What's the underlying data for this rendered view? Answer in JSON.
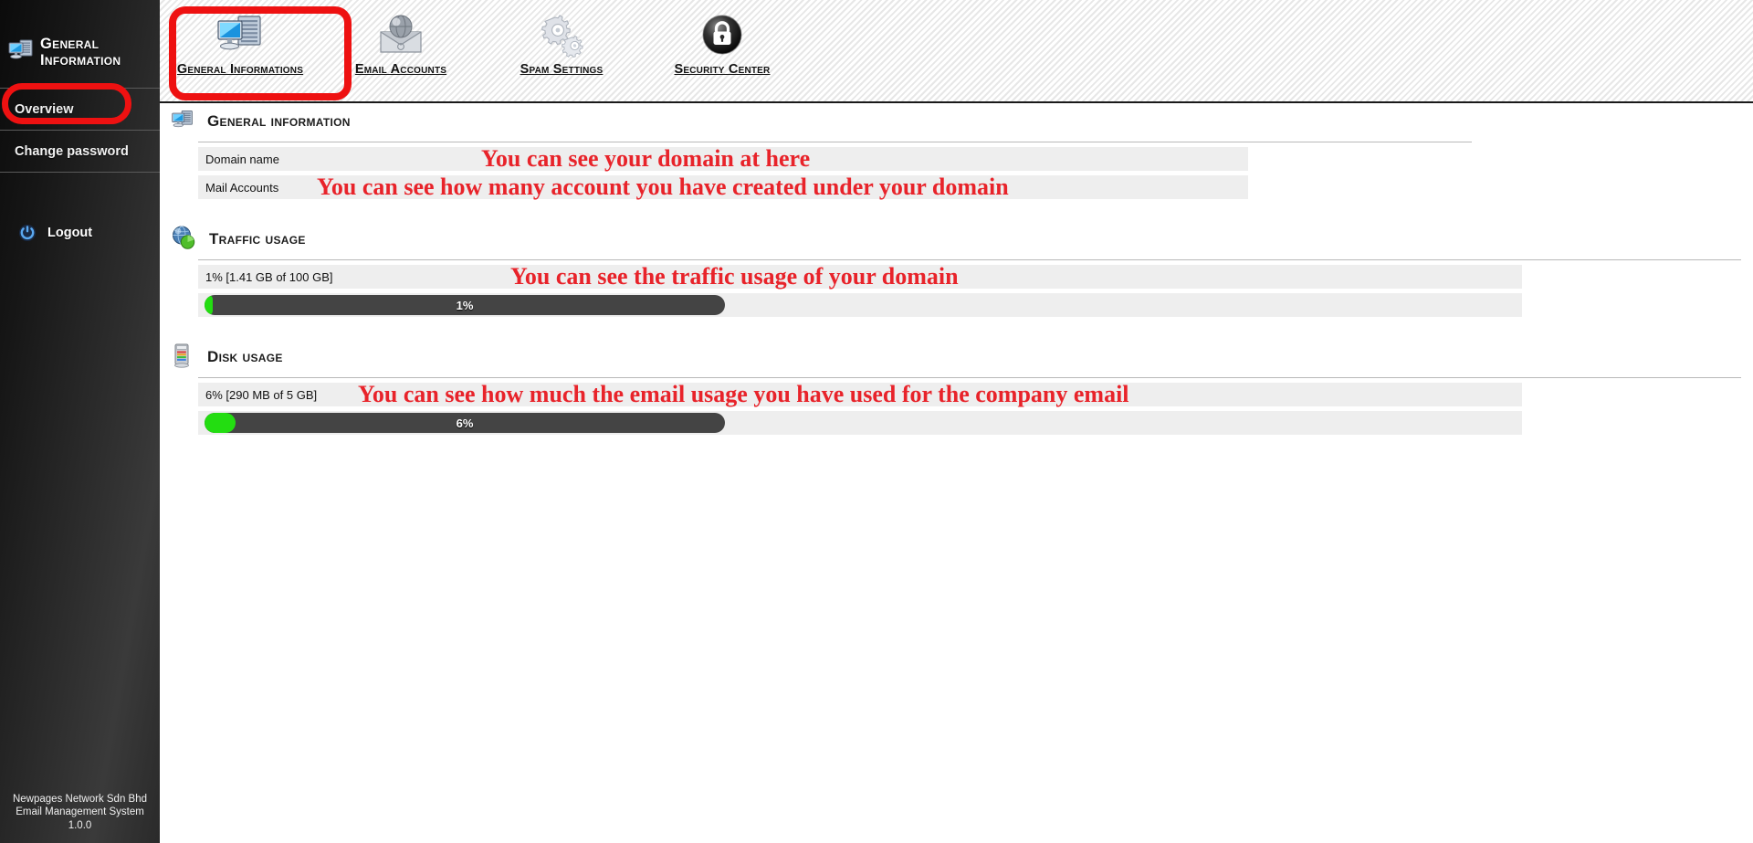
{
  "sidebar": {
    "brand": {
      "line1": "General",
      "line2": "Information",
      "icon": "computer-server-icon"
    },
    "items": [
      {
        "label": "Overview",
        "active": true
      },
      {
        "label": "Change password",
        "active": false
      }
    ],
    "logout": {
      "label": "Logout",
      "icon": "power-icon"
    },
    "footer": {
      "line1": "Newpages Network Sdn Bhd",
      "line2": "Email Management System",
      "line3": "1.0.0"
    },
    "highlight_color": "#ee1111"
  },
  "toolbar": {
    "items": [
      {
        "label": "General Informations",
        "icon": "computer-server-icon",
        "selected": true
      },
      {
        "label": "Email Accounts",
        "icon": "envelope-globe-icon",
        "selected": false
      },
      {
        "label": "Spam Settings",
        "icon": "gears-icon",
        "selected": false
      },
      {
        "label": "Security Center",
        "icon": "lock-shield-icon",
        "selected": false
      }
    ],
    "highlight_color": "#ee1111"
  },
  "sections": {
    "general": {
      "title": "General information",
      "icon": "computer-server-icon",
      "rows": [
        {
          "label": "Domain name",
          "value": "",
          "annotation": "You can see your domain at here"
        },
        {
          "label": "Mail Accounts",
          "value": "",
          "annotation": "You can see how many account you have created under your domain"
        }
      ]
    },
    "traffic": {
      "title": "Traffic usage",
      "icon": "globe-chart-icon",
      "summary": "1% [1.41 GB of 100 GB]",
      "annotation": "You can see the traffic usage of your domain",
      "percent_label": "1%",
      "percent_value": 1
    },
    "disk": {
      "title": "Disk usage",
      "icon": "hard-drive-icon",
      "summary": "6% [290 MB of 5 GB]",
      "annotation": "You can see how much the email usage you have used for the company email",
      "percent_label": "6%",
      "percent_value": 6
    }
  },
  "colors": {
    "annotation_red": "#e8232a",
    "bar_track": "#444444",
    "bar_fill": "#23dd11",
    "row_bg": "#eeeeee"
  }
}
